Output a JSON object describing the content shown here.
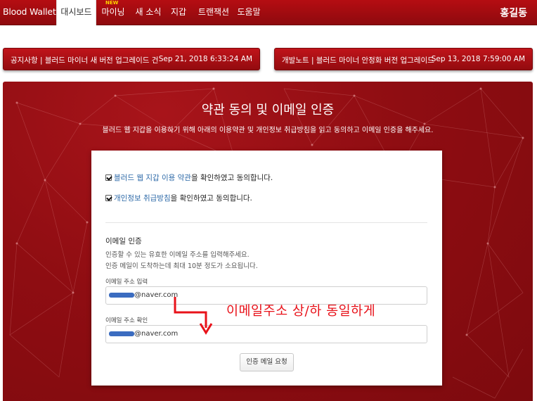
{
  "navbar": {
    "brand": "Blood Wallet",
    "items": [
      {
        "label": "대시보드",
        "active": true
      },
      {
        "label": "마이닝",
        "badge": "NEW"
      },
      {
        "label": "새 소식"
      },
      {
        "label": "지갑"
      },
      {
        "label": "트랜잭션"
      },
      {
        "label": "도움말"
      }
    ],
    "user": "홍길동"
  },
  "notices": [
    {
      "text": "공지사항 | 블러드 마이너 새 버전 업그레이드 건",
      "date": "Sep 21, 2018 6:33:24 AM"
    },
    {
      "text": "개발노트 | 블러드 마이너 안정화 버전 업그레이드",
      "date": "Sep 13, 2018 7:59:00 AM"
    }
  ],
  "panel": {
    "title": "약관 동의 및 이메일 인증",
    "subtitle": "블러드 웹 지갑을 이용하기 위해 아래의 이용약관 및 개인정보 취급방침을 읽고 동의하고 이메일 인증을 해주세요."
  },
  "terms": {
    "check1_link": "블러드 웹 지갑 이용 약관",
    "check1_suffix": "을 확인하였고 동의합니다.",
    "check2_link": "개인정보 취급방침",
    "check2_suffix": "을 확인하였고 동의합니다."
  },
  "email": {
    "section_title": "이메일 인증",
    "desc1": "인증할 수 있는 유효한 이메일 주소를 입력해주세요.",
    "desc2": "인증 메일이 도착하는데 최대 10분 정도가 소요됩니다.",
    "input_label": "이메일 주소 입력",
    "input_value": "@naver.com",
    "confirm_label": "이메일 주소 확인",
    "confirm_value": "@naver.com",
    "button": "인증 메일 요청"
  },
  "annotation": "이메일주소 상/하 동일하게",
  "colors": {
    "brand_red": "#a10f14",
    "link_blue": "#2e6aa8",
    "annotation_red": "#e8121a"
  }
}
